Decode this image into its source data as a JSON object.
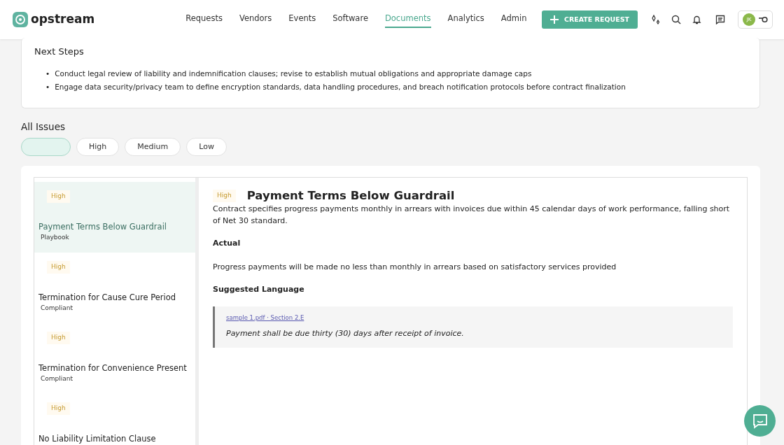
{
  "brand": "opstream",
  "nav": [
    {
      "label": "Requests",
      "selected": false
    },
    {
      "label": "Vendors",
      "selected": false
    },
    {
      "label": "Events",
      "selected": false
    },
    {
      "label": "Software",
      "selected": false
    },
    {
      "label": "Documents",
      "selected": true
    },
    {
      "label": "Analytics",
      "selected": false
    },
    {
      "label": "Admin",
      "selected": false
    }
  ],
  "create_button": "CREATE REQUEST",
  "avatar": "JK",
  "next_steps": {
    "title": "Next Steps",
    "items": [
      {
        "bullet": "•",
        "text": "Conduct legal review of liability and indemnification clauses; revise to establish mutual obligations and appropriate damage caps"
      },
      {
        "bullet": "•",
        "text": "Engage data security/privacy team to define encryption standards, data handling procedures, and breach notification protocols before contract finalization"
      }
    ]
  },
  "issues_title": "All Issues",
  "filters": [
    {
      "selected": true
    },
    {
      "label": "High",
      "selected": false
    },
    {
      "label": "Medium",
      "selected": false
    },
    {
      "label": "Low",
      "selected": false
    }
  ],
  "issues": [
    {
      "severity": "High",
      "title": "Payment Terms Below Guardrail",
      "status": "Playbook",
      "selected": true
    },
    {
      "severity": "High",
      "title": "Termination for Cause Cure Period",
      "status": "Compliant",
      "selected": false
    },
    {
      "severity": "High",
      "title": "Termination for Convenience Present",
      "status": "Compliant",
      "selected": false
    },
    {
      "severity": "High",
      "title": "No Liability Limitation Clause",
      "selected": false
    }
  ],
  "detail": {
    "severity": "High",
    "title": "Payment Terms Below Guardrail",
    "description": "Contract specifies progress payments monthly in arrears with invoices due within 45 calendar days of work performance, falling short of Net 30 standard.",
    "actual_label": "Actual",
    "actual": "Progress payments will be made no less than monthly in arrears based on satisfactory services provided",
    "suggested_label": "Suggested Language",
    "source": "sample 1.pdf · Section 2.E",
    "suggested": "Payment shall be due thirty (30) days after receipt of invoice."
  }
}
